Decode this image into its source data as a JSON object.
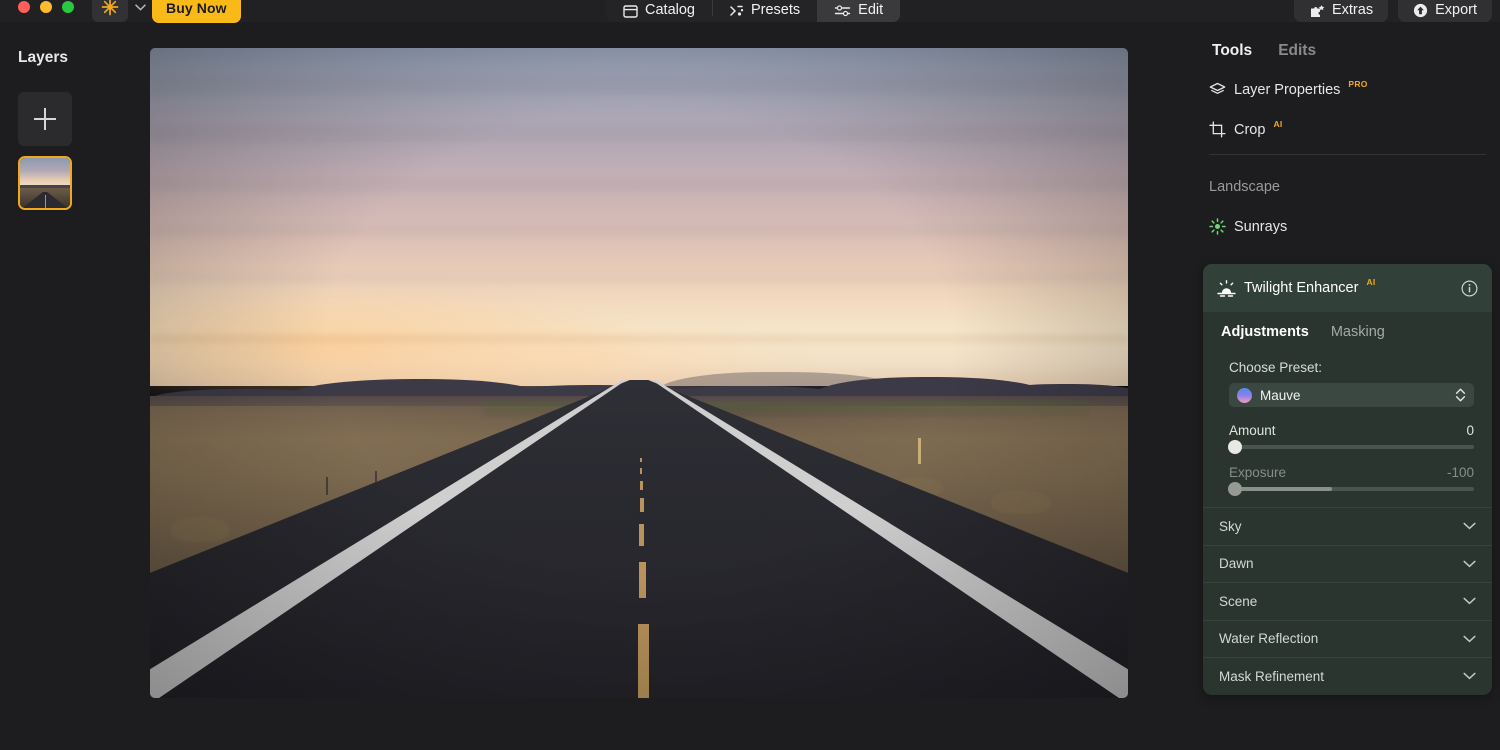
{
  "window": {
    "traffic_lights": [
      "close",
      "minimize",
      "zoom"
    ],
    "sun_button_label": "sunburst-icon",
    "buy_now_label": "Buy Now"
  },
  "nav": {
    "tabs": [
      {
        "label": "Catalog",
        "icon": "catalog-icon",
        "active": false
      },
      {
        "label": "Presets",
        "icon": "presets-icon",
        "active": false
      },
      {
        "label": "Edit",
        "icon": "sliders-icon",
        "active": true
      }
    ],
    "right_buttons": [
      {
        "label": "Extras",
        "icon": "puzzle-icon"
      },
      {
        "label": "Export",
        "icon": "export-icon"
      }
    ]
  },
  "layers": {
    "title": "Layers",
    "add_button_label": "+",
    "items": [
      {
        "name": "road-sunset-layer",
        "selected": true
      }
    ]
  },
  "tools_panel": {
    "tabs": [
      {
        "label": "Tools",
        "active": true
      },
      {
        "label": "Edits",
        "active": false
      }
    ],
    "tools": [
      {
        "label": "Layer Properties",
        "badge": "PRO",
        "icon": "layers-icon"
      },
      {
        "label": "Crop",
        "badge": "AI",
        "icon": "crop-icon"
      }
    ],
    "section_label": "Landscape",
    "landscape_tools": [
      {
        "label": "Sunrays",
        "icon": "sunrays-icon"
      }
    ],
    "active_filter": {
      "title": "Twilight Enhancer",
      "badge": "AI",
      "info_icon": "info-icon",
      "tabs": [
        {
          "label": "Adjustments",
          "active": true
        },
        {
          "label": "Masking",
          "active": false
        }
      ],
      "preset_label": "Choose Preset:",
      "preset_value": "Mauve",
      "preset_swatch_colors": [
        "#4d8ef0",
        "#f09ec0"
      ],
      "sliders": [
        {
          "label": "Amount",
          "value": "0",
          "fill_percent": 0,
          "disabled": false
        },
        {
          "label": "Exposure",
          "value": "-100",
          "fill_percent": 42,
          "disabled": true
        }
      ],
      "sections": [
        {
          "label": "Sky",
          "expanded": false
        },
        {
          "label": "Dawn",
          "expanded": false
        },
        {
          "label": "Scene",
          "expanded": false
        },
        {
          "label": "Water Reflection",
          "expanded": false
        },
        {
          "label": "Mask Refinement",
          "expanded": false
        }
      ]
    }
  },
  "colors": {
    "accent_gold": "#f9b919",
    "selection_border": "#f0a91e",
    "filter_card_bg": "#2b352f",
    "filter_header_bg": "#32403a",
    "panel_bg": "#1d1d1f",
    "badge_gold": "#f0a91e",
    "sunrays_green": "#6fd47a"
  }
}
